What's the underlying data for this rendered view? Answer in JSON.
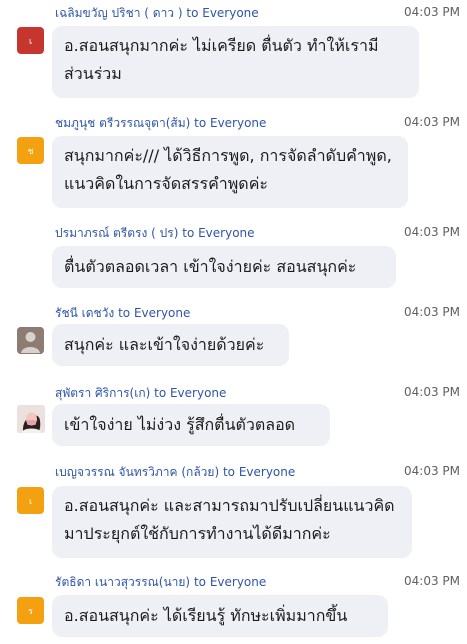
{
  "chat": {
    "messages": [
      {
        "sender": "เฉลิมขวัญ ปริชา ( ดาว )",
        "to": "to Everyone",
        "time": "04:03 PM",
        "avatar_text": "เ",
        "avatar_color": "#c7352f",
        "text": "อ.สอนสนุกมากค่ะ ไม่เครียด ตื่นตัว ทำให้เรามีส่วนร่วม"
      },
      {
        "sender": "ชมภูนุช ตรีวรรณจุตา(ส้ม)",
        "to": "to Everyone",
        "time": "04:03 PM",
        "avatar_text": "ช",
        "avatar_color": "#f3a011",
        "text": "สนุกมากค่ะ/// ได้วิธีการพูด, การจัดลำดับคำพูด, แนวคิดในการจัดสรรคำพูดค่ะ"
      },
      {
        "sender": "ปรมาภรณ์ ตรีตรง ( ปร)",
        "to": "to Everyone",
        "time": "04:03 PM",
        "avatar_text": "",
        "avatar_color": "",
        "text": "ตื่นตัวตลอดเวลา เข้าใจง่ายค่ะ สอนสนุกค่ะ"
      },
      {
        "sender": "รัชนี เดชวัง",
        "to": "to Everyone",
        "time": "04:03 PM",
        "avatar_text": "",
        "avatar_color": "#8e7b72",
        "text": "สนุกค่ะ และเข้าใจง่ายด้วยค่ะ"
      },
      {
        "sender": "สุพัตรา ศิริการ(เก)",
        "to": "to Everyone",
        "time": "04:03 PM",
        "avatar_text": "",
        "avatar_color": "#e6d2d0",
        "text": "เข้าใจง่าย ไม่ง่วง รู้สึกตื่นตัวตลอด"
      },
      {
        "sender": "เบญจวรรณ จันทรวิภาค (กล้วย)",
        "to": "to Everyone",
        "time": "04:03 PM",
        "avatar_text": "เ",
        "avatar_color": "#f3a011",
        "text": "อ.สอนสนุกค่ะ และสามารถมาปรับเปลี่ยนแนวคิดมาประยุกต์ใช้กับการทำงานได้ดีมากค่ะ"
      },
      {
        "sender": "รัตธิดา เนาวสุวรรณ(นาย)",
        "to": "to Everyone",
        "time": "04:03 PM",
        "avatar_text": "ร",
        "avatar_color": "#f3a011",
        "text": "อ.สอนสนุกค่ะ ได้เรียนรู้ ทักษะเพิ่มมากขึ้น"
      }
    ]
  }
}
